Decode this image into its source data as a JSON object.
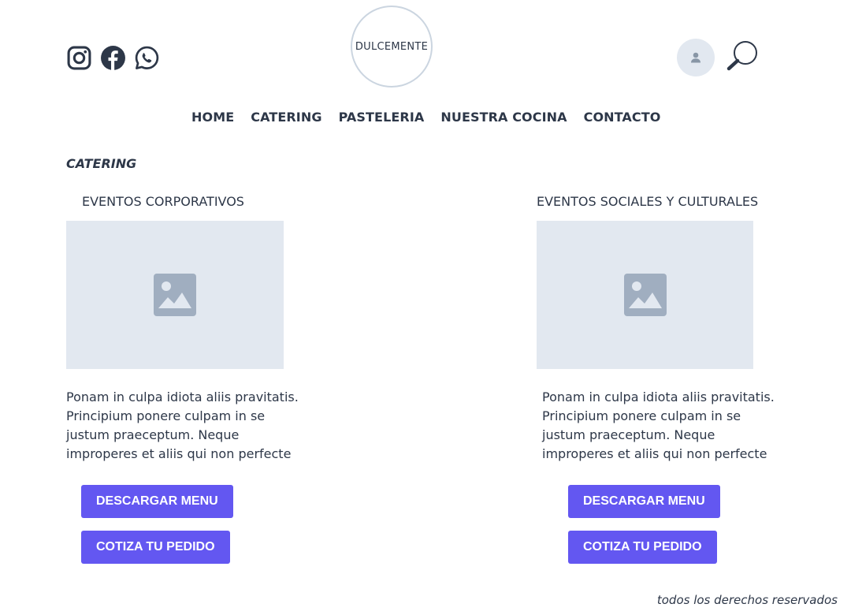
{
  "header": {
    "logo_text": "DULCEMENTE",
    "social_icons": [
      "instagram-icon",
      "facebook-icon",
      "whatsapp-icon"
    ]
  },
  "nav": {
    "items": [
      {
        "label": "HOME"
      },
      {
        "label": "CATERING"
      },
      {
        "label": "PASTELERIA"
      },
      {
        "label": "NUESTRA COCINA"
      },
      {
        "label": "CONTACTO"
      }
    ]
  },
  "page": {
    "title": "CATERING"
  },
  "sections": [
    {
      "title": "EVENTOS CORPORATIVOS",
      "description": "Ponam in culpa idiota aliis pravitatis. Principium ponere culpam in se justum praeceptum. Neque improperes et aliis qui non perfecte",
      "download_label": "DESCARGAR MENU",
      "quote_label": "COTIZA TU PEDIDO"
    },
    {
      "title": "EVENTOS SOCIALES Y CULTURALES",
      "description": "Ponam in culpa idiota aliis pravitatis. Principium ponere culpam in se justum praeceptum. Neque improperes et aliis qui non perfecte",
      "download_label": "DESCARGAR MENU",
      "quote_label": "COTIZA TU PEDIDO"
    }
  ],
  "footer": {
    "text": "todos los derechos reservados"
  },
  "colors": {
    "accent": "#6357f1",
    "text": "#2d3748",
    "placeholder": "#e2e8f0",
    "placeholder_icon": "#a0aec0"
  }
}
